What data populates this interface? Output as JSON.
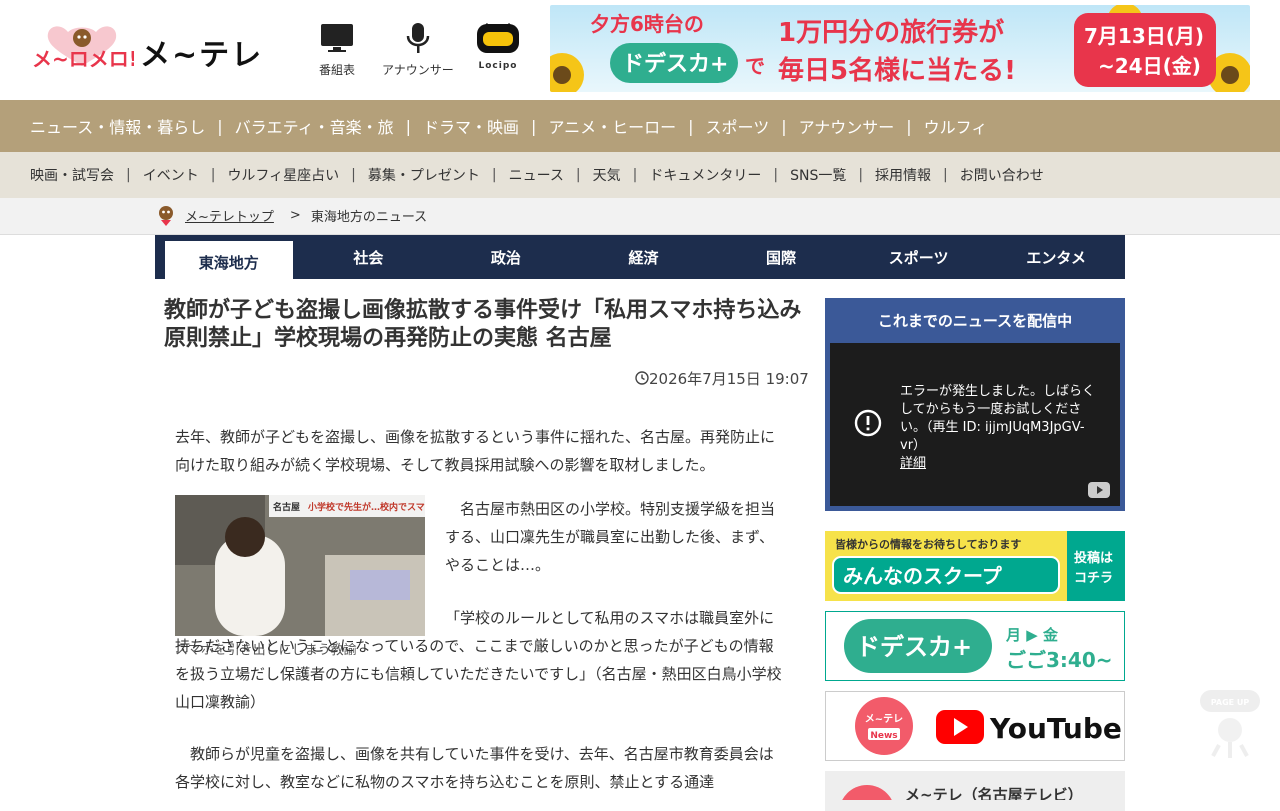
{
  "header": {
    "logo_mero": "メ~ロメロ!",
    "logo_text": "メ~テレ",
    "icons": [
      {
        "icon": "tv-icon",
        "label": "番組表"
      },
      {
        "icon": "microphone-icon",
        "label": "アナウンサー"
      },
      {
        "icon": "locipo-icon",
        "label": "Locipo"
      }
    ],
    "banner": {
      "line1": "夕方6時台の",
      "brand": "ドデスカ+",
      "de": "で",
      "prize": "1万円分の旅行券が",
      "daily": "毎日5名様に当たる!",
      "dates": "7月13日(月)",
      "dates2": "~24日(金)"
    }
  },
  "nav_main": [
    "ニュース・情報・暮らし",
    "バラエティ・音楽・旅",
    "ドラマ・映画",
    "アニメ・ヒーロー",
    "スポーツ",
    "アナウンサー",
    "ウルフィ"
  ],
  "nav_sub": [
    "映画・試写会",
    "イベント",
    "ウルフィ星座占い",
    "募集・プレゼント",
    "ニュース",
    "天気",
    "ドキュメンタリー",
    "SNS一覧",
    "採用情報",
    "お問い合わせ"
  ],
  "breadcrumb": {
    "home": "メ~テレトップ",
    "sep": ">",
    "current": "東海地方のニュース"
  },
  "categories": [
    "東海地方",
    "社会",
    "政治",
    "経済",
    "国際",
    "スポーツ",
    "エンタメ"
  ],
  "article": {
    "title": "教師が子ども盗撮し画像拡散する事件受け「私用スマホ持ち込み原則禁止」学校現場の再発防止の実態 名古屋",
    "date": "2026年7月15日 19:07",
    "lead": "去年、教師が子どもを盗撮し、画像を拡散するという事件に揺れた、名古屋。再発防止に向けた取り組みが続く学校現場、そして教員採用試験への影響を取材しました。",
    "photo_caption": "スマホを引き出しにしまう教諭",
    "photo_overlay": {
      "place": "名古屋",
      "headline": "小学校で先生が…校内でスマホ禁止"
    },
    "p1": "名古屋市熱田区の小学校。特別支援学級を担当する、山口凜先生が職員室に出勤した後、まず、やることは…。",
    "p2a": "「学校のルールとして私用のスマホは職員室外に持ちださないということになっているので、ここまで厳しいのかと思ったが子どもの情報を扱う立場だし保護者の方にも信頼していただきたいですし」（名古屋・熱田区白鳥小学校 山口凜教諭）",
    "p3": "教師らが児童を盗撮し、画像を共有していた事件を受け、去年、名古屋市教育委員会は各学校に対し、教室などに私物のスマホを持ち込むことを原則、禁止とする通達"
  },
  "sidebar": {
    "video_heading": "これまでのニュースを配信中",
    "video_error": "エラーが発生しました。しばらくしてからもう一度お試しください。（再生 ID: ijjmJUqM3JpGV-vr）",
    "video_error_link": "詳細",
    "scoop_top": "皆様からの情報をお待ちしております",
    "scoop_main": "みんなのスクープ",
    "scoop_side": "投稿はコチラ",
    "dodesuka_brand": "ドデスカ+",
    "dodesuka_days": "月 ▶ 金",
    "dodesuka_time": "ごご3:40~",
    "yt_badge": "メ~テレNews",
    "yt_label": "YouTube",
    "mtv_label": "メ~テレ（名古屋テレビ）"
  },
  "pageup": "PAGE UP",
  "colors": {
    "nav_main": "#b4a07a",
    "nav_sub": "#e6e2d8",
    "category_bar": "#1d2d4d",
    "video_box": "#3b5998",
    "scoop": "#00a88f"
  }
}
